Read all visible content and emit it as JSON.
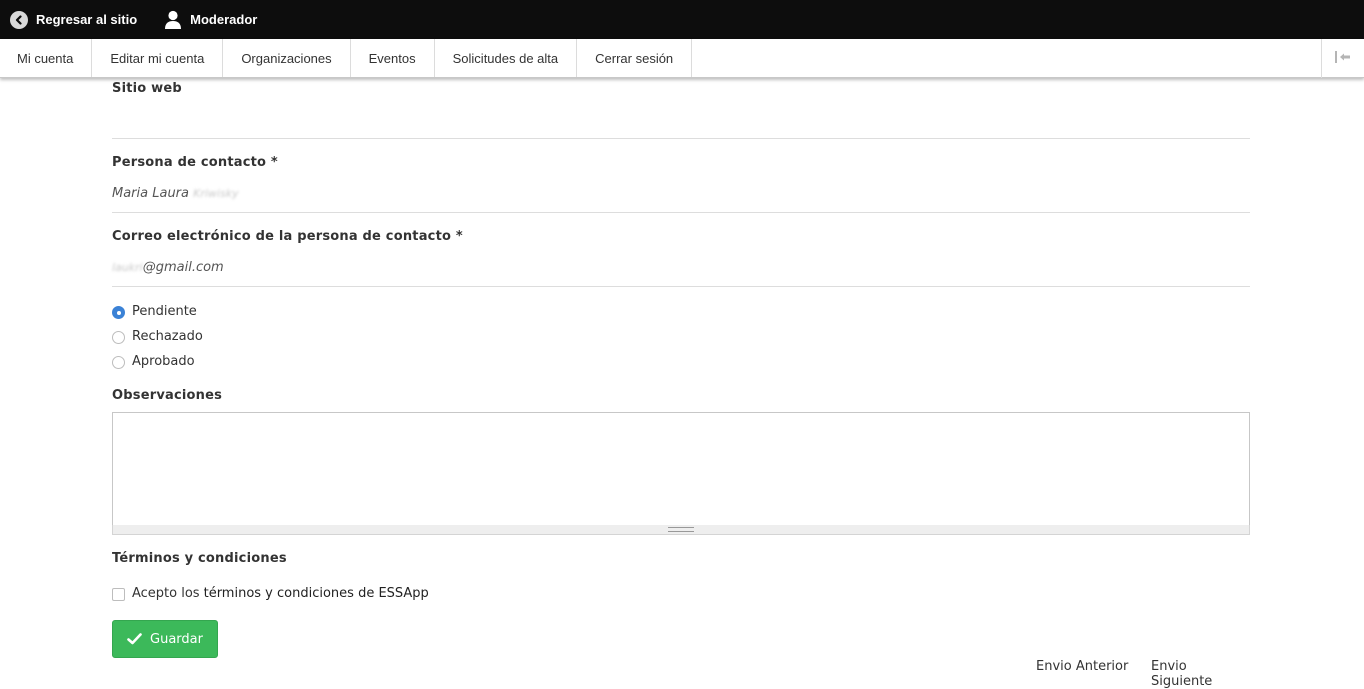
{
  "toolbar": {
    "back_label": "Regresar al sitio",
    "user_label": "Moderador"
  },
  "tray": {
    "tabs": [
      {
        "label": "Mi cuenta"
      },
      {
        "label": "Editar mi cuenta"
      },
      {
        "label": "Organizaciones"
      },
      {
        "label": "Eventos"
      },
      {
        "label": "Solicitudes de alta"
      },
      {
        "label": "Cerrar sesión"
      }
    ]
  },
  "form": {
    "website": {
      "label": "Sitio web",
      "value": ""
    },
    "contact_person": {
      "label": "Persona de contacto",
      "required_mark": "*",
      "value_visible": "Maria Laura",
      "value_redacted": "Kriwisky"
    },
    "contact_email": {
      "label": "Correo electrónico de la persona de contacto",
      "required_mark": "*",
      "value_redacted": "laukri",
      "value_visible": "@gmail.com"
    },
    "status": {
      "options": [
        {
          "label": "Pendiente",
          "selected": true
        },
        {
          "label": "Rechazado",
          "selected": false
        },
        {
          "label": "Aprobado",
          "selected": false
        }
      ]
    },
    "observations": {
      "label": "Observaciones",
      "value": ""
    },
    "terms": {
      "heading": "Términos y condiciones",
      "prefix": "Acepto los",
      "link": "términos y condiciones de ESSApp",
      "checked": false
    },
    "save_label": "Guardar"
  },
  "pager": {
    "prev_label": "Envio Anterior",
    "next_label": "Envio Siguiente"
  },
  "colors": {
    "toolbar_bg": "#0d0d0d",
    "save_green": "#3cb95a",
    "radio_selected": "#3b82d6"
  }
}
